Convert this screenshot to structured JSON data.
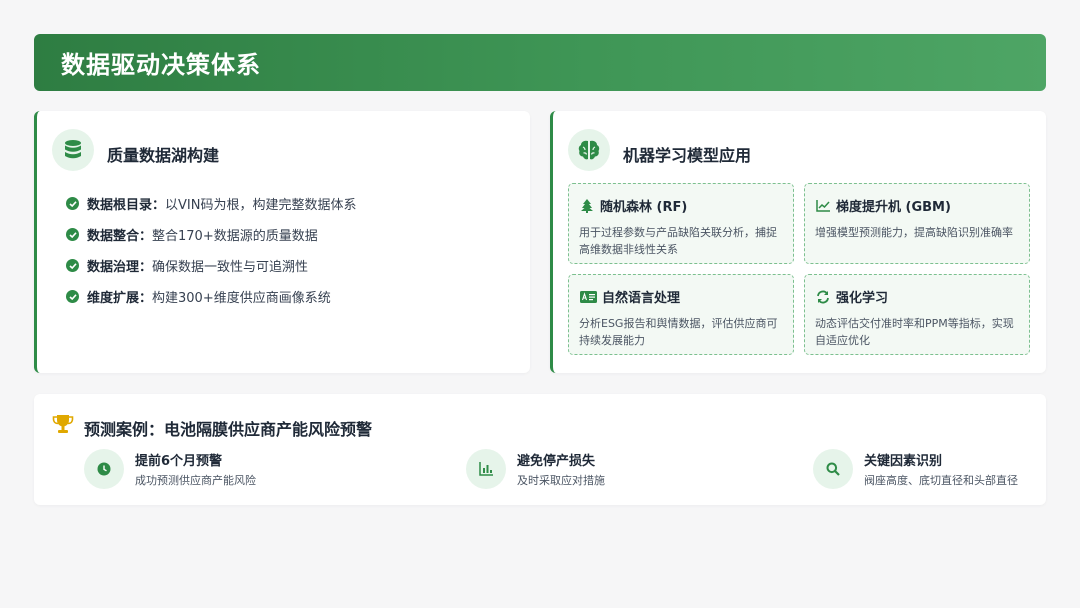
{
  "header": {
    "title": "数据驱动决策体系"
  },
  "data_lake": {
    "title": "质量数据湖构建",
    "icon": "database-icon",
    "items": [
      {
        "label": "数据根目录：",
        "text": "以VIN码为根，构建完整数据体系"
      },
      {
        "label": "数据整合：",
        "text": "整合170+数据源的质量数据"
      },
      {
        "label": "数据治理：",
        "text": "确保数据一致性与可追溯性"
      },
      {
        "label": "维度扩展：",
        "text": "构建300+维度供应商画像系统"
      }
    ]
  },
  "ml": {
    "title": "机器学习模型应用",
    "icon": "brain-icon",
    "models": [
      {
        "icon": "tree-icon",
        "title": "随机森林 (RF)",
        "desc": "用于过程参数与产品缺陷关联分析，捕捉高维数据非线性关系"
      },
      {
        "icon": "line-chart-icon",
        "title": "梯度提升机 (GBM)",
        "desc": "增强模型预测能力，提高缺陷识别准确率"
      },
      {
        "icon": "language-icon",
        "title": "自然语言处理",
        "desc": "分析ESG报告和舆情数据，评估供应商可持续发展能力"
      },
      {
        "icon": "sync-icon",
        "title": "强化学习",
        "desc": "动态评估交付准时率和PPM等指标，实现自适应优化"
      }
    ]
  },
  "case": {
    "icon": "trophy-icon",
    "title": "预测案例：电池隔膜供应商产能风险预警",
    "stats": [
      {
        "icon": "clock-icon",
        "title": "提前6个月预警",
        "sub": "成功预测供应商产能风险"
      },
      {
        "icon": "bar-chart-icon",
        "title": "避免停产损失",
        "sub": "及时采取应对措施"
      },
      {
        "icon": "search-icon",
        "title": "关键因素识别",
        "sub": "阀座高度、底切直径和头部直径"
      }
    ]
  },
  "colors": {
    "brand": "#2e8b47",
    "icon_bg": "#e6f4ea",
    "trophy": "#e0a800"
  }
}
